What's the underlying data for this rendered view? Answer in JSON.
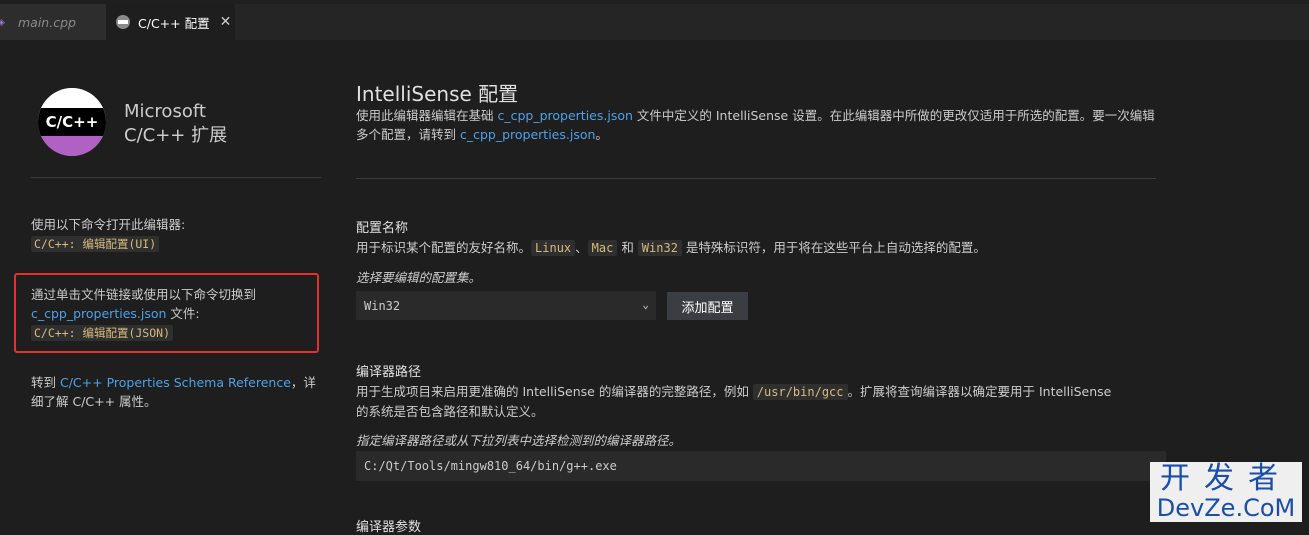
{
  "tabs": [
    {
      "label": "main.cpp",
      "active": false
    },
    {
      "label": "C/C++ 配置",
      "active": true,
      "close": "✕"
    }
  ],
  "extension": {
    "logo_text": "C/C++",
    "name_line1": "Microsoft",
    "name_line2": "C/C++ 扩展",
    "logo_colors": {
      "top": "#ffffff",
      "band": "#000000",
      "bottom": "#b062c4"
    }
  },
  "sidebar": {
    "open_cmd_text": "使用以下命令打开此编辑器:",
    "open_cmd_code": "C/C++: 编辑配置(UI)",
    "switch_text": "通过单击文件链接或使用以下命令切换到",
    "switch_link": "c_cpp_properties.json",
    "switch_suffix": " 文件:",
    "switch_code": "C/C++: 编辑配置(JSON)",
    "ref_prefix": "转到 ",
    "ref_link": "C/C++ Properties Schema Reference",
    "ref_suffix": "，详细了解 C/C++ 属性。"
  },
  "main": {
    "title": "IntelliSense 配置",
    "desc_part1": "使用此编辑器编辑在基础 ",
    "desc_link1": "c_cpp_properties.json",
    "desc_part2": " 文件中定义的 IntelliSense 设置。在此编辑器中所做的更改仅适用于所选的配置。要一次编辑多个配置，请转到 ",
    "desc_link2": "c_cpp_properties.json",
    "desc_part3": "。",
    "config_name": {
      "title": "配置名称",
      "desc_prefix": "用于标识某个配置的友好名称。",
      "code1": "Linux",
      "sep1": "、",
      "code2": "Mac",
      "sep2": " 和 ",
      "code3": "Win32",
      "desc_suffix": " 是特殊标识符，用于将在这些平台上自动选择的配置。",
      "hint": "选择要编辑的配置集。",
      "selected": "Win32",
      "add_button": "添加配置"
    },
    "compiler_path": {
      "title": "编译器路径",
      "desc_prefix": "用于生成项目来启用更准确的 IntelliSense 的编译器的完整路径，例如 ",
      "code": "/usr/bin/gcc",
      "desc_suffix": "。扩展将查询编译器以确定要用于 IntelliSense 的系统是否包含路径和默认定义。",
      "hint": "指定编译器路径或从下拉列表中选择检测到的编译器路径。",
      "value": "C:/Qt/Tools/mingw810_64/bin/g++.exe"
    },
    "compiler_args": {
      "title": "编译器参数"
    }
  },
  "watermark": {
    "line1": "开发者",
    "line2": "DevZe.CoM"
  },
  "colors": {
    "background": "#1e1e1e",
    "link": "#4fa1e8",
    "highlight": "#e5312e",
    "code_text": "#d7ba7d"
  }
}
